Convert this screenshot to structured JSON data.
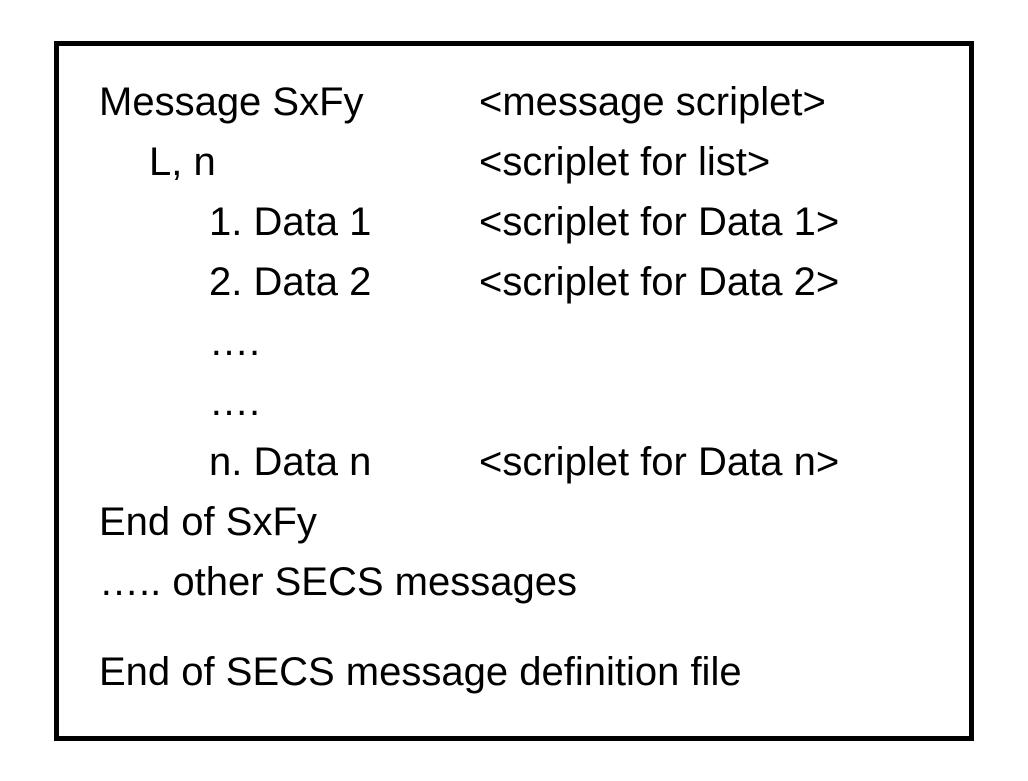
{
  "rows": [
    {
      "left": "Message SxFy",
      "right": "<message scriplet>",
      "indent": 0
    },
    {
      "left": "L, n",
      "right": "<scriplet for list>",
      "indent": 1
    },
    {
      "left": "1. Data 1",
      "right": "<scriplet for Data 1>",
      "indent": 2
    },
    {
      "left": "2. Data 2",
      "right": "<scriplet for Data 2>",
      "indent": 2
    },
    {
      "left": "….",
      "right": "",
      "indent": 2
    },
    {
      "left": "….",
      "right": "",
      "indent": 2
    },
    {
      "left": "n.  Data n",
      "right": "<scriplet for Data n>",
      "indent": 2
    }
  ],
  "line_end1": "End of SxFy",
  "line_other": "….. other SECS messages",
  "line_end2": "End  of SECS message definition file"
}
